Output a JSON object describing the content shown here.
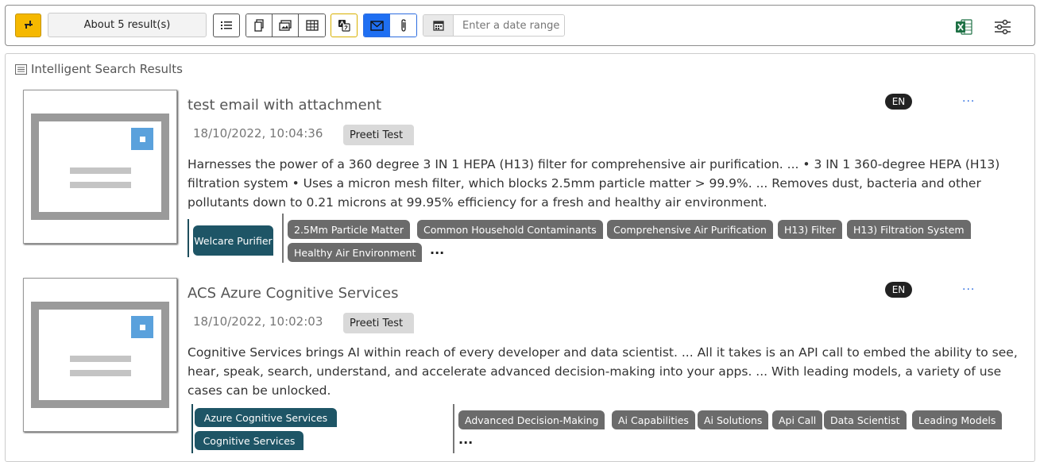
{
  "toolbar": {
    "result_count": "About 5 result(s)",
    "date_placeholder": "Enter a date range"
  },
  "panel": {
    "title": "Intelligent Search Results"
  },
  "results": [
    {
      "title": "test email with attachment",
      "language": "EN",
      "more": "...",
      "date": "18/10/2022, 10:04:36",
      "author": "Preeti Test",
      "summary": "Harnesses the power of a 360 degree 3 IN 1 HEPA (H13) filter for comprehensive air purification. ... • 3 IN 1 360-degree HEPA (H13) filtration system • Uses a micron mesh filter, which blocks 2.5mm particle matter > 99.9%. ... Removes dust, bacteria and other pollutants down to 0.21 microns at 99.95% efficiency for a fresh and healthy air environment.",
      "entities": [
        "Welcare Purifier"
      ],
      "keywords": [
        "2.5Mm Particle Matter",
        "Common Household Contaminants",
        "Comprehensive Air Purification",
        "H13) Filter",
        "H13) Filtration System",
        "Healthy Air Environment"
      ],
      "keywords_more": "..."
    },
    {
      "title": "ACS Azure Cognitive Services",
      "language": "EN",
      "more": "...",
      "date": "18/10/2022, 10:02:03",
      "author": "Preeti Test",
      "summary": "Cognitive Services brings AI within reach of every developer and data scientist. ... All it takes is an API call to embed the ability to see, hear, speak, search, understand, and accelerate advanced decision-making into your apps. ... With leading models, a variety of use cases can be unlocked.",
      "entities": [
        "Azure Cognitive Services",
        "Cognitive Services"
      ],
      "keywords": [
        "Advanced Decision-Making",
        "Ai Capabilities",
        "Ai Solutions",
        "Api Call",
        "Data Scientist",
        "Leading Models"
      ],
      "keywords_more": "..."
    }
  ],
  "icons": {
    "pin": "pin-icon",
    "list": "list-icon",
    "copy": "copy-icon",
    "image": "image-icon",
    "table": "table-icon",
    "translate": "translate-icon",
    "mail": "mail-icon",
    "attachment": "paperclip-icon",
    "calendar": "calendar-icon",
    "excel": "excel-icon",
    "filter": "sliders-icon"
  },
  "colors": {
    "pin_button": "#f5b800",
    "mail_active": "#1f6ff2",
    "entity_tag": "#1e5566",
    "keyword_tag": "#6b6b6b",
    "excel_green": "#1e7145"
  }
}
